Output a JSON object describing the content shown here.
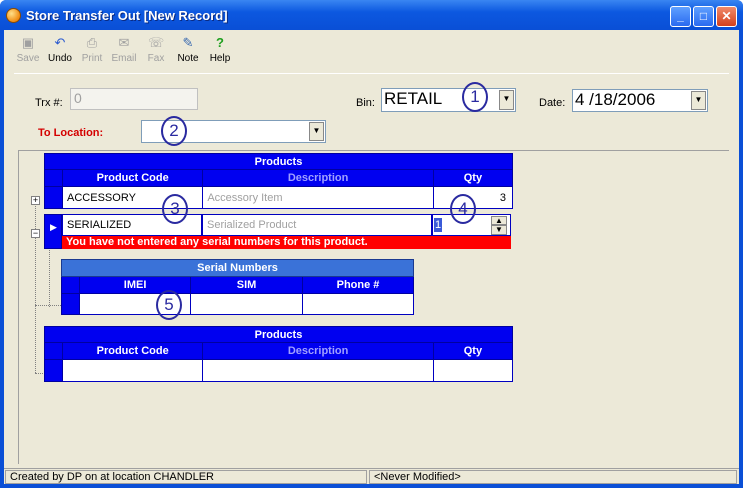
{
  "window": {
    "title": "Store Transfer Out [New Record]",
    "min": "_",
    "max": "□",
    "close": "✕"
  },
  "toolbar": {
    "save": "Save",
    "undo": "Undo",
    "print": "Print",
    "email": "Email",
    "fax": "Fax",
    "note": "Note",
    "help": "Help"
  },
  "header": {
    "trx_label": "Trx #:",
    "trx_value": "0",
    "bin_label": "Bin:",
    "bin_value": "RETAIL",
    "date_label": "Date:",
    "date_value": "4 /18/2006",
    "to_location_label": "To Location:",
    "to_location_value": ""
  },
  "annotations": [
    "1",
    "2",
    "3",
    "4",
    "5"
  ],
  "products": {
    "title": "Products",
    "columns": [
      "Product Code",
      "Description",
      "Qty"
    ],
    "rows": [
      {
        "code": "ACCESSORY",
        "description": "Accessory Item",
        "qty": "3"
      },
      {
        "code": "SERIALIZED",
        "description": "Serialized Product",
        "qty": "1"
      }
    ],
    "error": "You have not entered any serial numbers for this product."
  },
  "serials": {
    "title": "Serial Numbers",
    "columns": [
      "IMEI",
      "SIM",
      "Phone #"
    ]
  },
  "products2": {
    "title": "Products",
    "columns": [
      "Product Code",
      "Description",
      "Qty"
    ]
  },
  "status": {
    "created": "Created by DP on  at location CHANDLER",
    "modified": "<Never Modified>"
  }
}
